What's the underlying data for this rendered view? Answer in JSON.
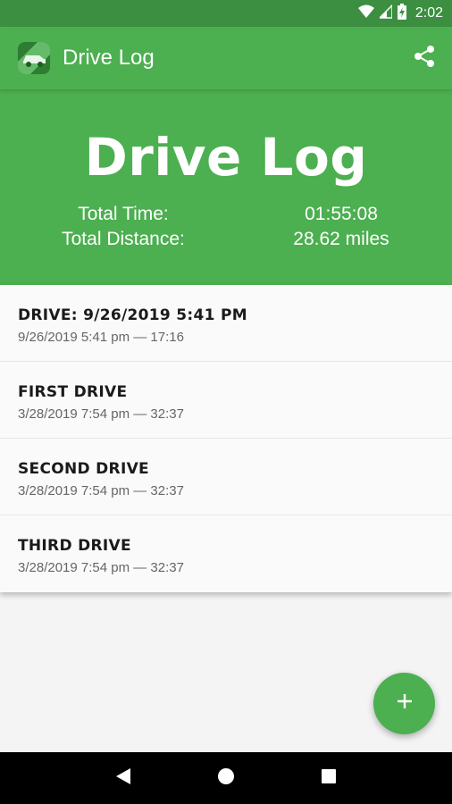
{
  "status_bar": {
    "time": "2:02",
    "icons": [
      "wifi-icon",
      "signal-icon",
      "battery-charging-icon"
    ]
  },
  "app_bar": {
    "title": "Drive Log",
    "icon": "car-app-icon",
    "share_icon": "share-icon"
  },
  "summary": {
    "title": "Drive Log",
    "total_time_label": "Total Time:",
    "total_time_value": "01:55:08",
    "total_distance_label": "Total Distance:",
    "total_distance_value": "28.62 miles"
  },
  "drives": [
    {
      "name": "DRIVE: 9/26/2019 5:41 PM",
      "subtitle": "9/26/2019 5:41 pm — 17:16"
    },
    {
      "name": "FIRST DRIVE",
      "subtitle": "3/28/2019 7:54 pm — 32:37"
    },
    {
      "name": "SECOND DRIVE",
      "subtitle": "3/28/2019 7:54 pm — 32:37"
    },
    {
      "name": "THIRD DRIVE",
      "subtitle": "3/28/2019 7:54 pm — 32:37"
    }
  ],
  "fab": {
    "icon": "plus-icon"
  },
  "nav_bar": {
    "icons": [
      "back-icon",
      "home-icon",
      "recents-icon"
    ]
  },
  "colors": {
    "primary": "#4caf50",
    "status_bar": "#3c8f40",
    "app_icon": "#2e7d32",
    "background": "#f4f4f4"
  }
}
